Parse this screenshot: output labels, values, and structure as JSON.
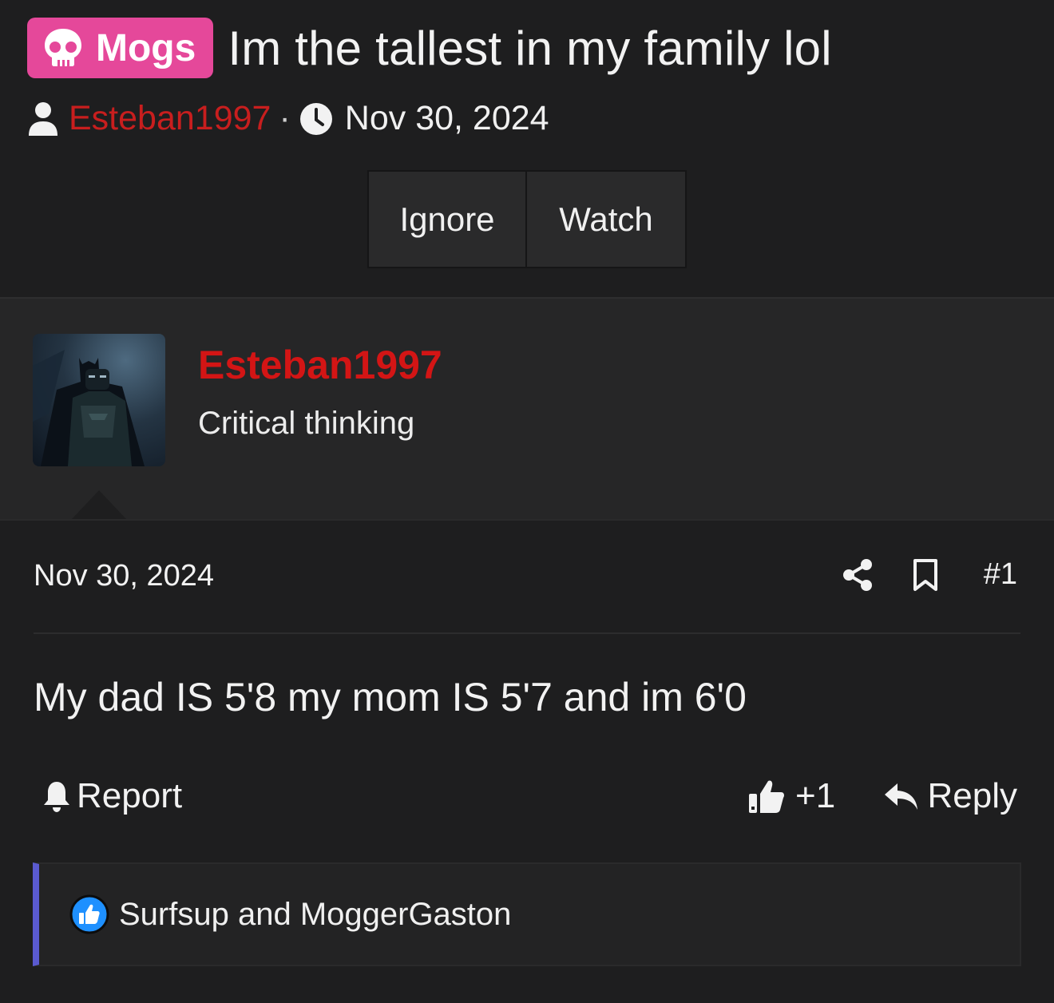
{
  "thread": {
    "prefix": "Mogs",
    "title": "Im the tallest in my family lol",
    "author": "Esteban1997",
    "separator": "·",
    "date": "Nov 30, 2024",
    "buttons": {
      "ignore": "Ignore",
      "watch": "Watch"
    }
  },
  "user": {
    "name": "Esteban1997",
    "title": "Critical thinking"
  },
  "post": {
    "date": "Nov 30, 2024",
    "number": "#1",
    "body": "My dad IS 5'8 my mom IS 5'7 and im 6'0",
    "report_label": "Report",
    "like_label": "+1",
    "reply_label": "Reply",
    "reactions_users": "Surfsup and MoggerGaston"
  },
  "colors": {
    "prefix_bg": "#e5489a",
    "author": "#d31515",
    "reaction_bar": "#5a5ad0",
    "reaction_icon": "#1e90ff"
  },
  "icons": [
    "skull-icon",
    "user-icon",
    "clock-icon",
    "share-icon",
    "bookmark-icon",
    "bell-icon",
    "thumbs-up-icon",
    "reply-arrow-icon",
    "like-reaction-icon"
  ]
}
